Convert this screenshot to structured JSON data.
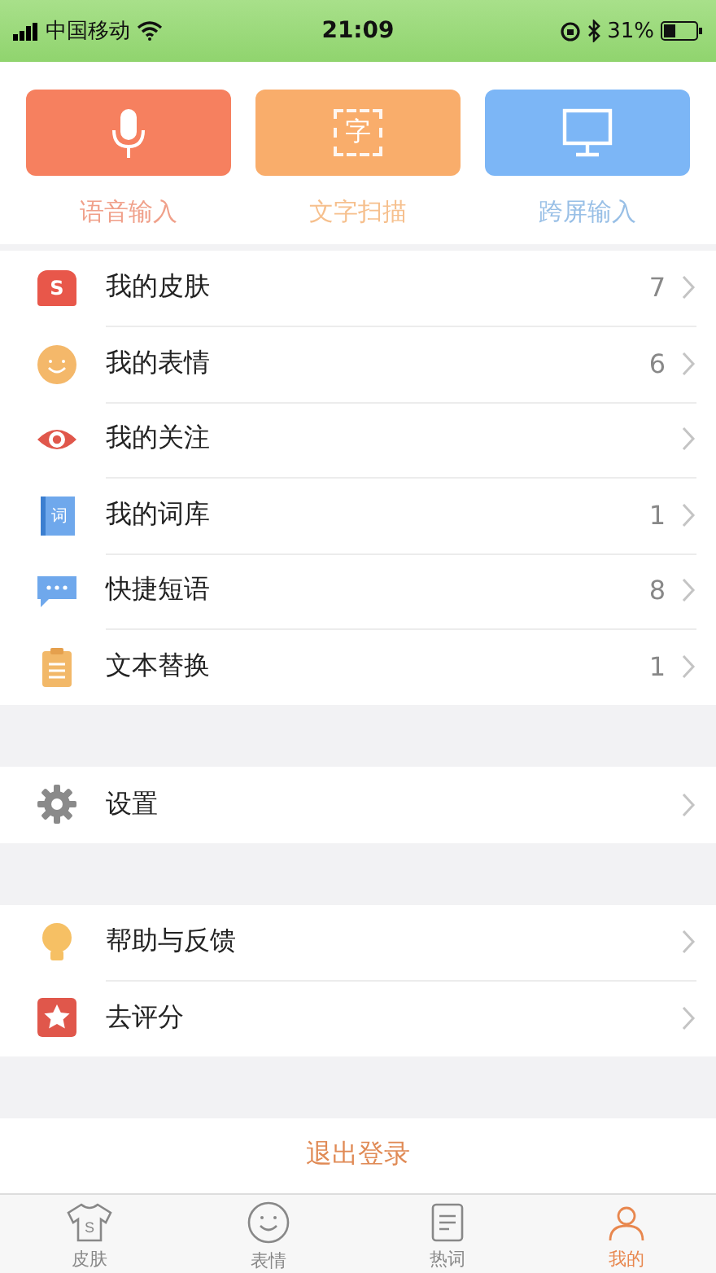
{
  "status_bar": {
    "carrier": "中国移动",
    "time": "21:09",
    "battery": "31%"
  },
  "quick_actions": [
    {
      "kind": "mic",
      "label": "语音输入"
    },
    {
      "kind": "scan",
      "label": "文字扫描",
      "icon_text": "字"
    },
    {
      "kind": "screen",
      "label": "跨屏输入"
    }
  ],
  "menu_groups": [
    [
      {
        "kind": "skin",
        "label": "我的皮肤",
        "count": "7",
        "icon_text": "S"
      },
      {
        "kind": "emoji",
        "label": "我的表情",
        "count": "6"
      },
      {
        "kind": "eye",
        "label": "我的关注"
      },
      {
        "kind": "dict",
        "label": "我的词库",
        "count": "1",
        "icon_text": "词"
      },
      {
        "kind": "chat",
        "label": "快捷短语",
        "count": "8"
      },
      {
        "kind": "clipboard",
        "label": "文本替换",
        "count": "1"
      }
    ],
    [
      {
        "kind": "gear",
        "label": "设置"
      }
    ],
    [
      {
        "kind": "bulb",
        "label": "帮助与反馈"
      },
      {
        "kind": "star",
        "label": "去评分"
      }
    ]
  ],
  "logout": "退出登录",
  "tab_bar": [
    {
      "kind": "skin",
      "label": "皮肤",
      "icon_text": "S",
      "selected": false
    },
    {
      "kind": "emoji",
      "label": "表情",
      "selected": false
    },
    {
      "kind": "hot",
      "label": "热词",
      "selected": false
    },
    {
      "kind": "me",
      "label": "我的",
      "selected": true
    }
  ]
}
